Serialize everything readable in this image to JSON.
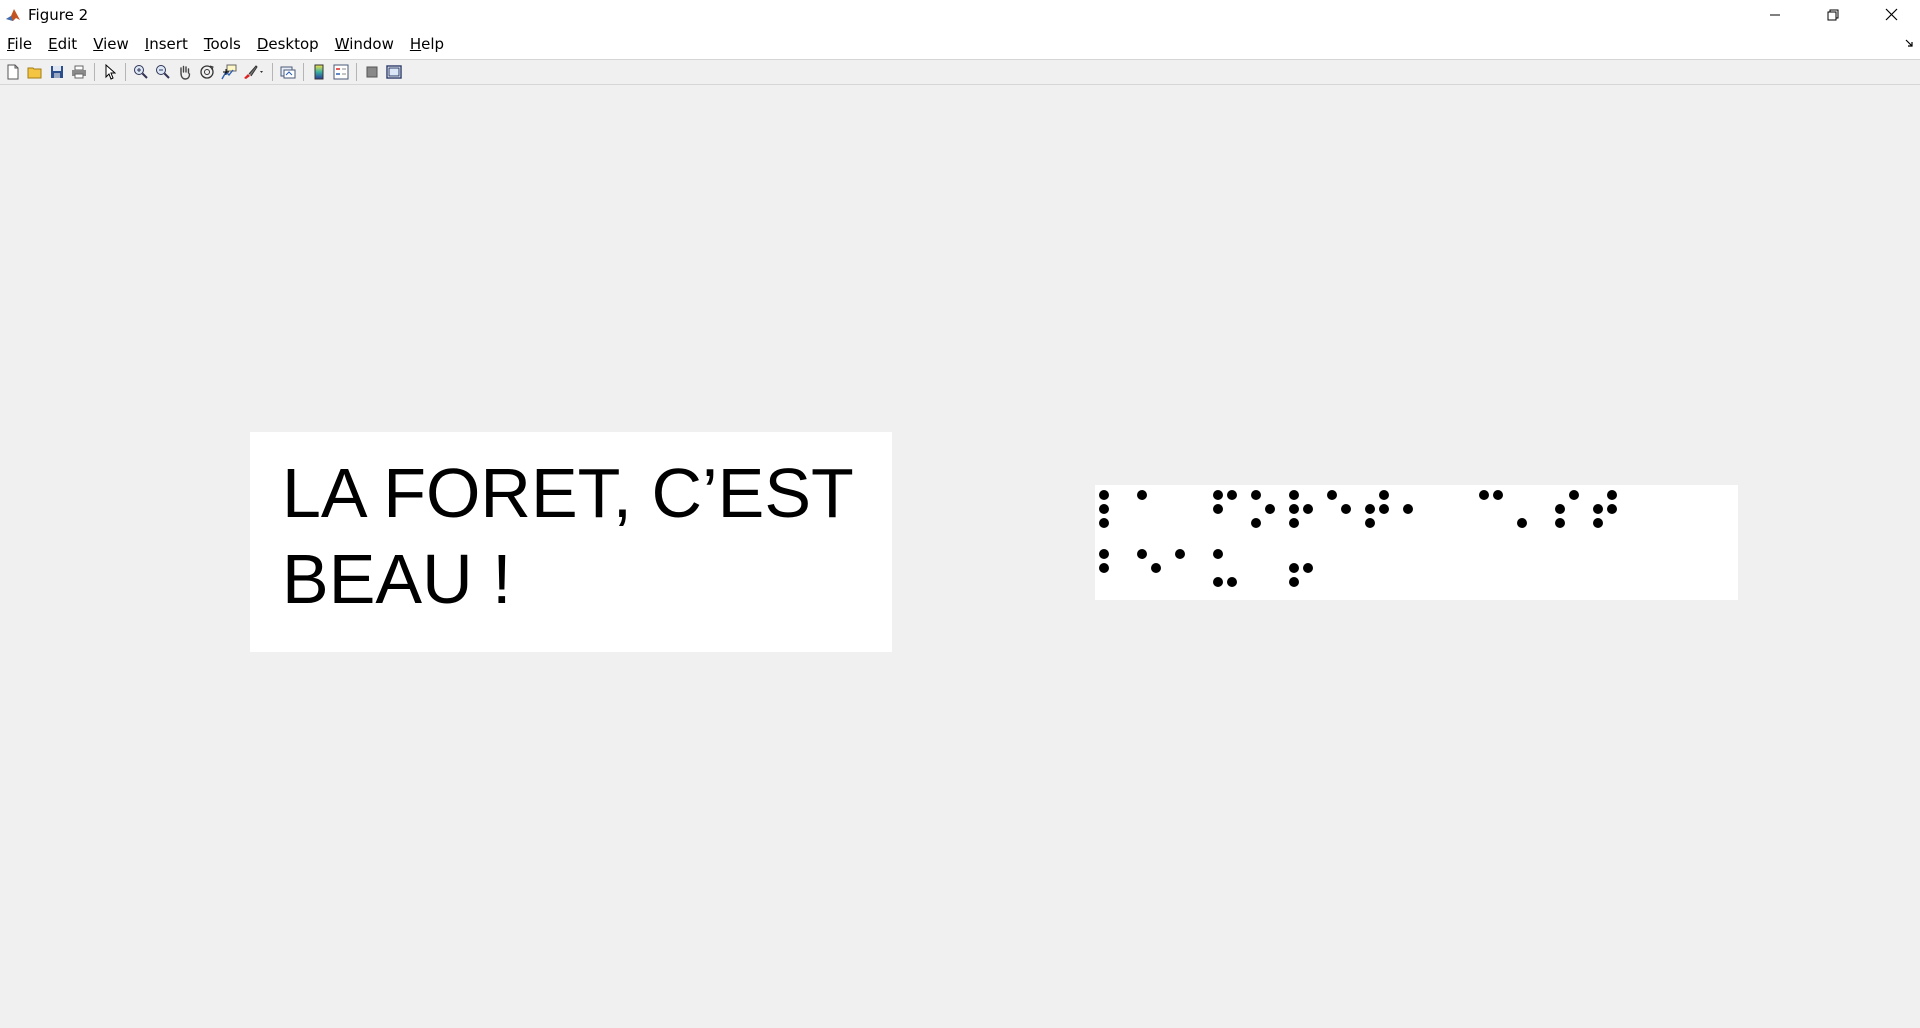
{
  "window": {
    "title": "Figure 2",
    "controls": [
      "minimize-icon",
      "restore-icon",
      "close-icon"
    ]
  },
  "menu": {
    "items": [
      {
        "name": "file",
        "label": "File",
        "mnemonic": "F"
      },
      {
        "name": "edit",
        "label": "Edit",
        "mnemonic": "E"
      },
      {
        "name": "view",
        "label": "View",
        "mnemonic": "V"
      },
      {
        "name": "insert",
        "label": "Insert",
        "mnemonic": "I"
      },
      {
        "name": "tools",
        "label": "Tools",
        "mnemonic": "T"
      },
      {
        "name": "desktop",
        "label": "Desktop",
        "mnemonic": "D"
      },
      {
        "name": "window",
        "label": "Window",
        "mnemonic": "W"
      },
      {
        "name": "help",
        "label": "Help",
        "mnemonic": "H"
      }
    ]
  },
  "toolbar": {
    "icons": [
      "new-figure-icon",
      "open-file-icon",
      "save-icon",
      "print-icon",
      "edit-plot-icon",
      "zoom-in-icon",
      "zoom-out-icon",
      "pan-icon",
      "rotate-3d-icon",
      "data-cursor-icon",
      "brush-icon",
      "link-plot-icon",
      "colorbar-icon",
      "legend-icon",
      "hide-plot-tools-icon",
      "show-plot-tools-icon"
    ]
  },
  "figure": {
    "text_lines": [
      "LA FORET, C’EST",
      "BEAU !"
    ],
    "braille": {
      "description_colors": {
        "dot": "#000000",
        "panel": "#ffffff"
      },
      "rows": [
        [
          "⠇",
          "⠁",
          " ",
          "⠋",
          "⠕",
          "⠗",
          "⠑",
          "⠞",
          "⠂",
          " ",
          "⠉",
          "⠄",
          "⠎",
          "⠞"
        ],
        [
          "⠃",
          "⠑",
          "⠁",
          "⠥",
          " ",
          "⠖"
        ]
      ]
    }
  },
  "colors": {
    "titlebar": "#ffffff",
    "menubar": "#ffffff",
    "background": "#f0f0f0",
    "panel": "#ffffff"
  }
}
